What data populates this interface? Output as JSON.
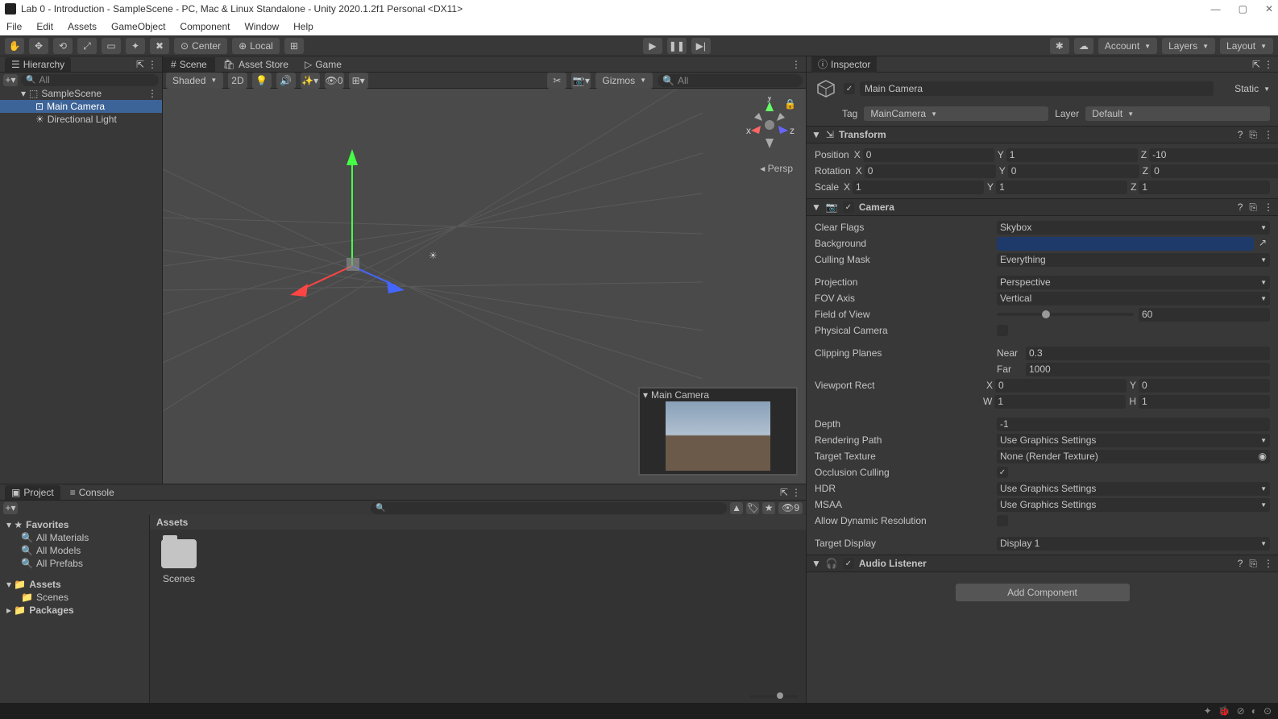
{
  "window": {
    "title": "Lab 0 - Introduction - SampleScene - PC, Mac & Linux Standalone - Unity 2020.1.2f1 Personal <DX11>"
  },
  "menu": [
    "File",
    "Edit",
    "Assets",
    "GameObject",
    "Component",
    "Window",
    "Help"
  ],
  "toolbar": {
    "pivot": "Center",
    "space": "Local",
    "account": "Account",
    "layers": "Layers",
    "layout": "Layout"
  },
  "hierarchy": {
    "tab": "Hierarchy",
    "search_placeholder": "All",
    "scene": "SampleScene",
    "items": [
      "Main Camera",
      "Directional Light"
    ],
    "selected": 0
  },
  "scene_tabs": {
    "scene": "Scene",
    "asset_store": "Asset Store",
    "game": "Game"
  },
  "scene_toolbar": {
    "shading": "Shaded",
    "mode2d": "2D",
    "gizmos": "Gizmos",
    "search_placeholder": "All"
  },
  "scene": {
    "preview_label": "Main Camera",
    "proj_label": "Persp"
  },
  "project": {
    "tabs": {
      "project": "Project",
      "console": "Console"
    },
    "favorites": "Favorites",
    "fav_items": [
      "All Materials",
      "All Models",
      "All Prefabs"
    ],
    "assets": "Assets",
    "asset_items": [
      "Scenes"
    ],
    "packages": "Packages",
    "breadcrumb": "Assets",
    "folder": "Scenes",
    "hidden_count": "9"
  },
  "inspector": {
    "tab": "Inspector",
    "object_name": "Main Camera",
    "static_label": "Static",
    "tag_label": "Tag",
    "tag_value": "MainCamera",
    "layer_label": "Layer",
    "layer_value": "Default",
    "transform": {
      "title": "Transform",
      "position_label": "Position",
      "position": {
        "x": "0",
        "y": "1",
        "z": "-10"
      },
      "rotation_label": "Rotation",
      "rotation": {
        "x": "0",
        "y": "0",
        "z": "0"
      },
      "scale_label": "Scale",
      "scale": {
        "x": "1",
        "y": "1",
        "z": "1"
      }
    },
    "camera": {
      "title": "Camera",
      "clear_flags_label": "Clear Flags",
      "clear_flags": "Skybox",
      "background_label": "Background",
      "culling_mask_label": "Culling Mask",
      "culling_mask": "Everything",
      "projection_label": "Projection",
      "projection": "Perspective",
      "fov_axis_label": "FOV Axis",
      "fov_axis": "Vertical",
      "fov_label": "Field of View",
      "fov": "60",
      "physical_label": "Physical Camera",
      "clipping_label": "Clipping Planes",
      "near_label": "Near",
      "near": "0.3",
      "far_label": "Far",
      "far": "1000",
      "viewport_label": "Viewport Rect",
      "viewport": {
        "x": "0",
        "y": "0",
        "w": "1",
        "h": "1"
      },
      "depth_label": "Depth",
      "depth": "-1",
      "rendering_path_label": "Rendering Path",
      "rendering_path": "Use Graphics Settings",
      "target_texture_label": "Target Texture",
      "target_texture": "None (Render Texture)",
      "occlusion_label": "Occlusion Culling",
      "hdr_label": "HDR",
      "hdr": "Use Graphics Settings",
      "msaa_label": "MSAA",
      "msaa": "Use Graphics Settings",
      "dynamic_res_label": "Allow Dynamic Resolution",
      "target_display_label": "Target Display",
      "target_display": "Display 1"
    },
    "audio_listener": {
      "title": "Audio Listener"
    },
    "add_component": "Add Component"
  }
}
